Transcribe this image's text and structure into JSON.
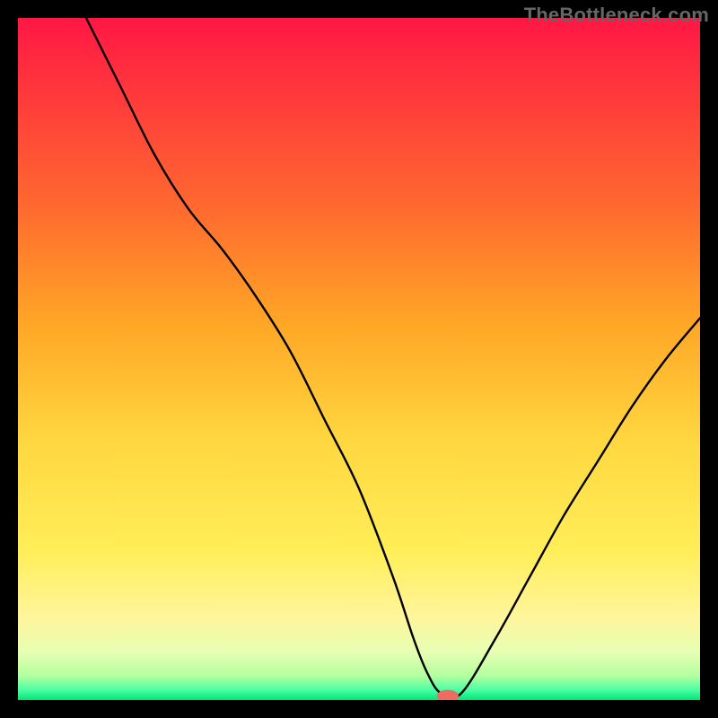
{
  "watermark": "TheBottleneck.com",
  "chart_data": {
    "type": "line",
    "title": "",
    "xlabel": "",
    "ylabel": "",
    "xlim": [
      0,
      100
    ],
    "ylim": [
      0,
      100
    ],
    "grid": false,
    "legend": false,
    "background_gradient_stops": [
      {
        "offset": 0.0,
        "color": "#ff1744"
      },
      {
        "offset": 0.12,
        "color": "#ff3b3b"
      },
      {
        "offset": 0.28,
        "color": "#ff6a2f"
      },
      {
        "offset": 0.45,
        "color": "#ffa726"
      },
      {
        "offset": 0.62,
        "color": "#ffd740"
      },
      {
        "offset": 0.78,
        "color": "#ffee58"
      },
      {
        "offset": 0.88,
        "color": "#fff59d"
      },
      {
        "offset": 0.93,
        "color": "#e6ffb3"
      },
      {
        "offset": 0.965,
        "color": "#b2ff9e"
      },
      {
        "offset": 0.985,
        "color": "#4cffa4"
      },
      {
        "offset": 1.0,
        "color": "#00e676"
      }
    ],
    "series": [
      {
        "name": "bottleneck-curve",
        "color": "#000000",
        "stroke_width": 2.4,
        "x": [
          10,
          15,
          20,
          25,
          30,
          35,
          40,
          45,
          50,
          55,
          58,
          60,
          62,
          65,
          70,
          75,
          80,
          85,
          90,
          95,
          100
        ],
        "y": [
          100,
          90,
          80,
          72,
          66,
          59,
          51,
          41,
          31,
          18,
          9,
          4,
          1,
          1,
          9,
          18,
          27,
          35,
          43,
          50,
          56
        ]
      }
    ],
    "marker": {
      "name": "optimal-marker",
      "color": "#ef6b62",
      "cx": 63,
      "cy": 0.6,
      "rx": 1.6,
      "ry": 0.9
    }
  }
}
